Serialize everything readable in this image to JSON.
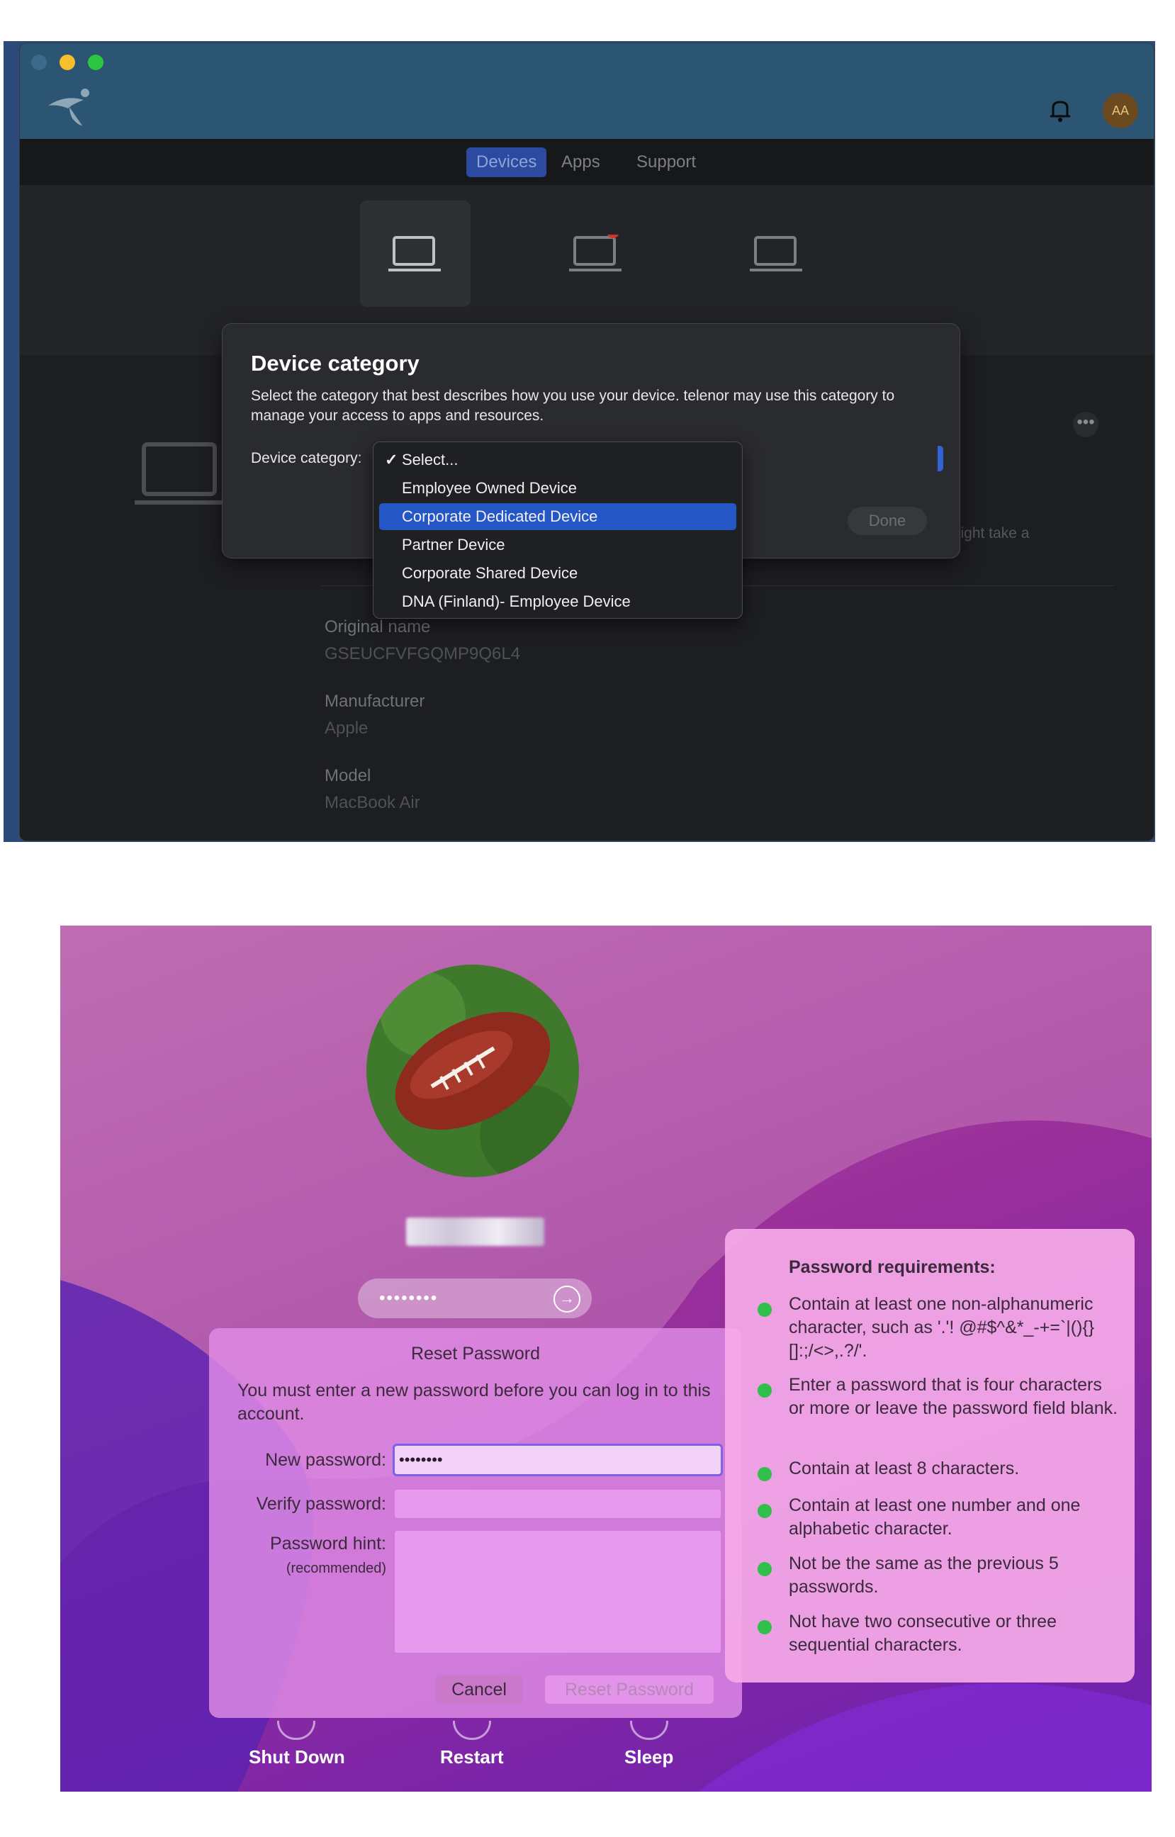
{
  "portal": {
    "avatar_initials": "AA",
    "tabs": [
      "Devices",
      "Apps",
      "Support"
    ],
    "dialog": {
      "title": "Device category",
      "description": "Select the category that best describes how you use your device. telenor may use this category to manage your access to apps and resources.",
      "field_label": "Device category:",
      "done_label": "Done"
    },
    "dropdown": {
      "selected_index": 0,
      "highlighted_index": 2,
      "check_mark": "✓",
      "options": [
        "Select...",
        "Employee Owned Device",
        "Corporate Dedicated Device",
        "Partner Device",
        "Corporate Shared Device",
        "DNA (Finland)- Employee Device"
      ]
    },
    "side_text": "might take a",
    "details": {
      "original_name_label": "Original name",
      "original_name_value": "GSEUCFVFGQMP9Q6L4",
      "manufacturer_label": "Manufacturer",
      "manufacturer_value": "Apple",
      "model_label": "Model",
      "model_value": "MacBook Air"
    },
    "more_icon": "•••",
    "colors": {
      "title_bar": "#2c5574",
      "active_tab": "#2b4aa0",
      "highlight": "#2556c6"
    }
  },
  "login": {
    "password_dots": "••••••••",
    "arrow_icon": "→",
    "reset": {
      "title": "Reset Password",
      "message": "You must enter a new password before you can log in to this account.",
      "new_password_label": "New password:",
      "new_password_value": "••••••••",
      "verify_label": "Verify password:",
      "hint_label": "Password hint:",
      "hint_sub": "(recommended)",
      "cancel_label": "Cancel",
      "reset_label": "Reset Password"
    },
    "requirements": {
      "title": "Password requirements:",
      "items": [
        "Contain at least one non-alphanumeric character, such as '.'! @#$^&*_-+=`|(){}[]:;/<>,.?/'.",
        "Enter a password that is four characters or more or leave the password field blank.",
        "Contain at least 8 characters.",
        "Contain at least one number and one alphabetic character.",
        "Not be the same as the previous 5 passwords.",
        "Not have two consecutive or three sequential characters."
      ],
      "dot_color": "#2fbf4a"
    },
    "power": {
      "shutdown": "Shut Down",
      "restart": "Restart",
      "sleep": "Sleep"
    }
  }
}
